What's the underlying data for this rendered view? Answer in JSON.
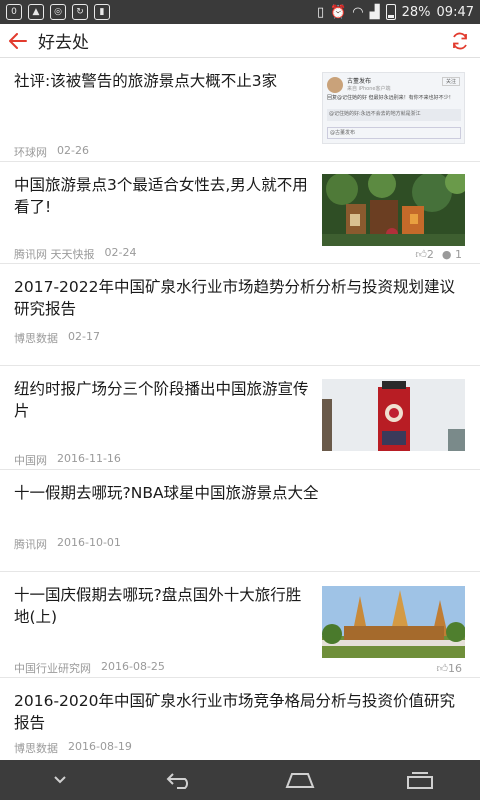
{
  "status_bar": {
    "battery": "28%",
    "time": "09:47",
    "left_icons": [
      "notification-icon",
      "image-icon",
      "location-icon",
      "sync-icon",
      "sd-icon"
    ],
    "right_icons": [
      "vibrate-icon",
      "alarm-icon",
      "wifi-icon",
      "signal-icon",
      "battery-icon"
    ]
  },
  "header": {
    "title": "好去处"
  },
  "items": [
    {
      "title": "社评:该被警告的旅游景点大概不止3家",
      "source": "环球网",
      "date": "02-26"
    },
    {
      "title": "中国旅游景点3个最适合女性去,男人就不用看了!",
      "source": "腾讯网 天天快报",
      "date": "02-24",
      "likes": "2",
      "comments": "1"
    },
    {
      "title": "2017-2022年中国矿泉水行业市场趋势分析分析与投资规划建议研究报告",
      "source": "博思数据",
      "date": "02-17"
    },
    {
      "title": "纽约时报广场分三个阶段播出中国旅游宣传片",
      "source": "中国网",
      "date": "2016-11-16"
    },
    {
      "title": "十一假期去哪玩?NBA球星中国旅游景点大全",
      "source": "腾讯网",
      "date": "2016-10-01"
    },
    {
      "title": "十一国庆假期去哪玩?盘点国外十大旅行胜地(上)",
      "source": "中国行业研究网",
      "date": "2016-08-25",
      "likes": "16"
    },
    {
      "title": "2016-2020年中国矿泉水行业市场竞争格局分析与投资价值研究报告",
      "source": "博思数据",
      "date": "2016-08-19"
    }
  ],
  "thumb1": {
    "user": "古董发布",
    "via": "来自 iPhone客户端",
    "button": "关注",
    "line1": "回复@记住她的好 但最好永远别来！有你不来也好不少！",
    "line2": "@记住她的好:永远不会去的地方就是浙江",
    "footer": "@古董发布"
  },
  "colors": {
    "accent": "#e23b2e"
  }
}
